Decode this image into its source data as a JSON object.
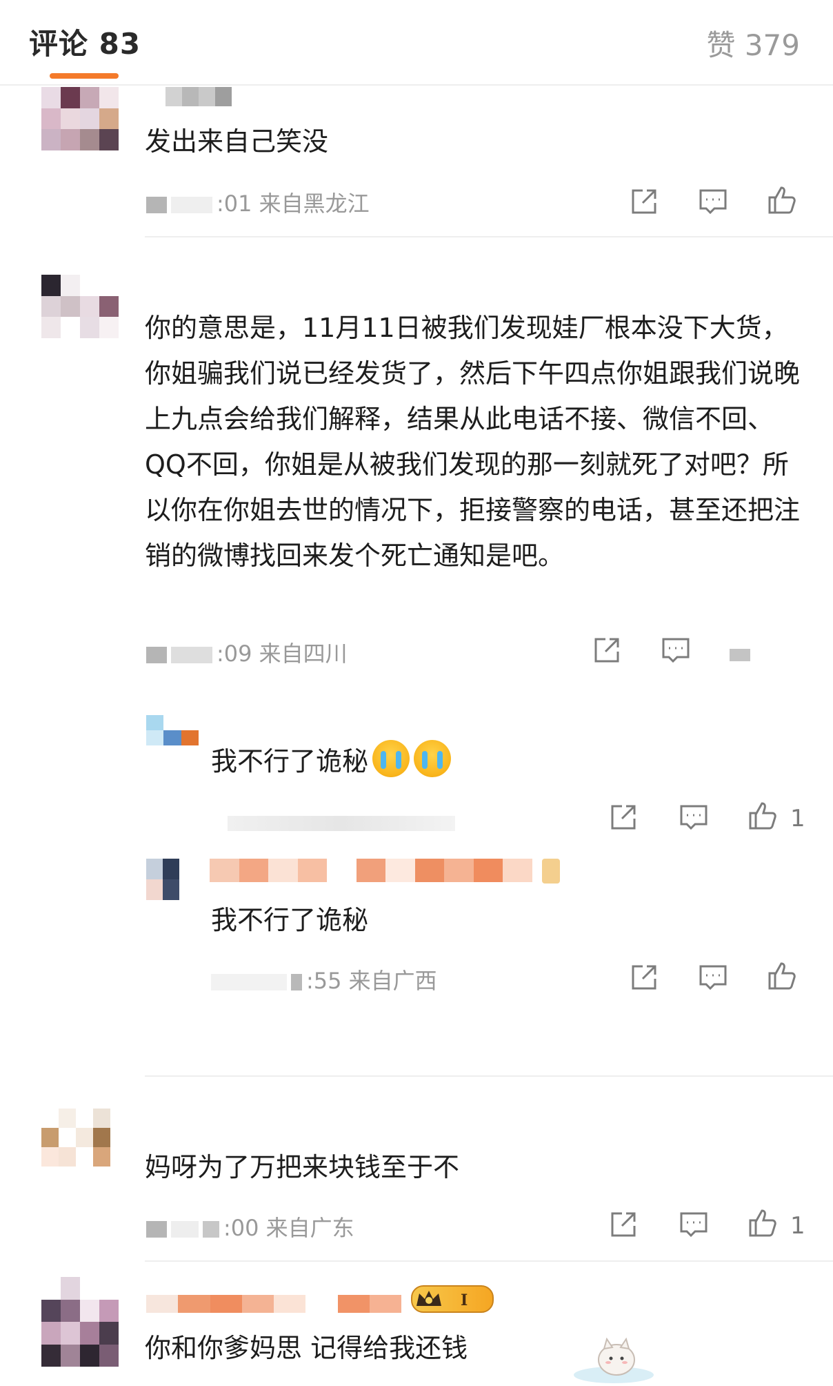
{
  "header": {
    "comments_label": "评论 83",
    "likes_label": "赞 379"
  },
  "comments": [
    {
      "text": "发出来自己笑没",
      "meta": ":01 来自黑龙江"
    },
    {
      "text": "你的意思是，11月11日被我们发现娃厂根本没下大货，你姐骗我们说已经发货了，然后下午四点你姐跟我们说晚上九点会给我们解释，结果从此电话不接、微信不回、QQ不回，你姐是从被我们发现的那一刻就死了对吧？所以你在你姐去世的情况下，拒接警察的电话，甚至还把注销的微博找回来发个死亡通知是吧。",
      "meta": ":09 来自四川",
      "replies": [
        {
          "text": "我不行了诡秘",
          "like_count": "1"
        },
        {
          "text": "我不行了诡秘",
          "meta": ":55 来自广西"
        }
      ]
    },
    {
      "text": "妈呀为了万把来块钱至于不",
      "meta": ":00 来自广东",
      "like_count": "1"
    },
    {
      "text": "你和你爹妈思 记得给我还钱"
    }
  ],
  "icons": {
    "share": "share-icon",
    "comment": "comment-icon",
    "like": "thumbs-up-icon",
    "crying": "crying-emoji-icon",
    "vip": "crown-badge-icon"
  },
  "colors": {
    "accent": "#f47a2a",
    "muted": "#999999",
    "divider": "#eeeeee"
  }
}
